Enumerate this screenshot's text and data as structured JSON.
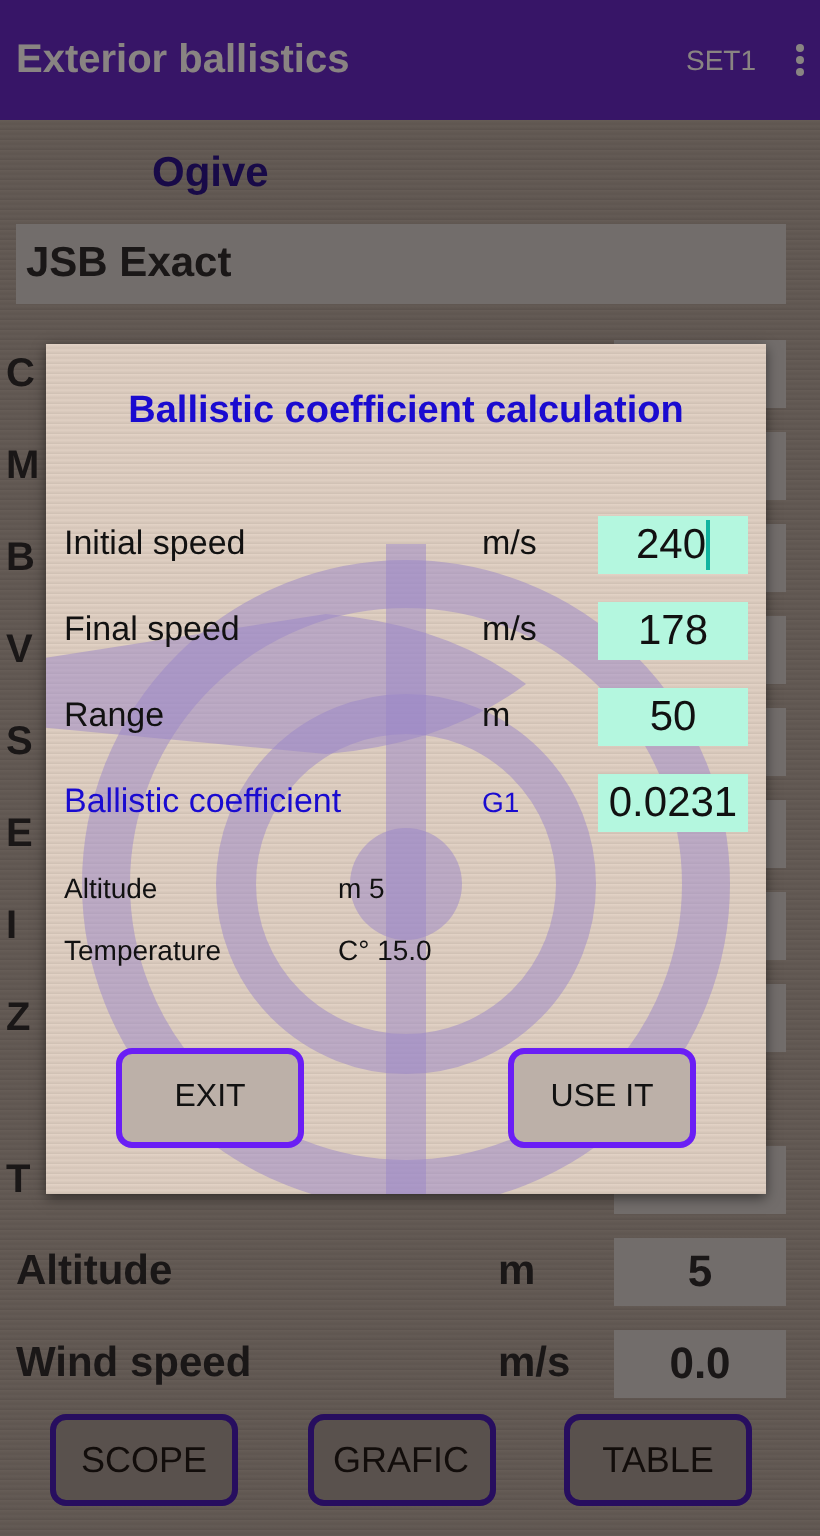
{
  "app_bar": {
    "title": "Exterior ballistics",
    "action": "SET1"
  },
  "section_title": "Ogive",
  "projectile": "JSB Exact",
  "hidden_rows": [
    {
      "label": "C"
    },
    {
      "label": "M"
    },
    {
      "label": "B"
    },
    {
      "label": "V"
    },
    {
      "label": "S"
    },
    {
      "label": "E"
    },
    {
      "label": "I"
    },
    {
      "label": "Z"
    },
    {
      "label": "T"
    }
  ],
  "rows": [
    {
      "label": "Altitude",
      "unit": "m",
      "value": "5"
    },
    {
      "label": "Wind speed",
      "unit": "m/s",
      "value": "0.0"
    }
  ],
  "buttons": [
    "SCOPE",
    "GRAFIC",
    "TABLE"
  ],
  "dialog": {
    "title": "Ballistic coefficient calculation",
    "fields": [
      {
        "kind": "input",
        "label": "Initial speed",
        "unit": "m/s",
        "value": "240",
        "focused": true
      },
      {
        "kind": "input",
        "label": "Final speed",
        "unit": "m/s",
        "value": "178",
        "focused": false
      },
      {
        "kind": "input",
        "label": "Range",
        "unit": "m",
        "value": "50",
        "focused": false
      },
      {
        "kind": "result",
        "label": "Ballistic coefficient",
        "unit": "G1",
        "value": "0.0231",
        "focused": false
      }
    ],
    "info": [
      {
        "label": "Altitude",
        "value": "m 5"
      },
      {
        "label": "Temperature",
        "value": "C° 15.0"
      }
    ],
    "buttons": [
      "EXIT",
      "USE IT"
    ]
  }
}
